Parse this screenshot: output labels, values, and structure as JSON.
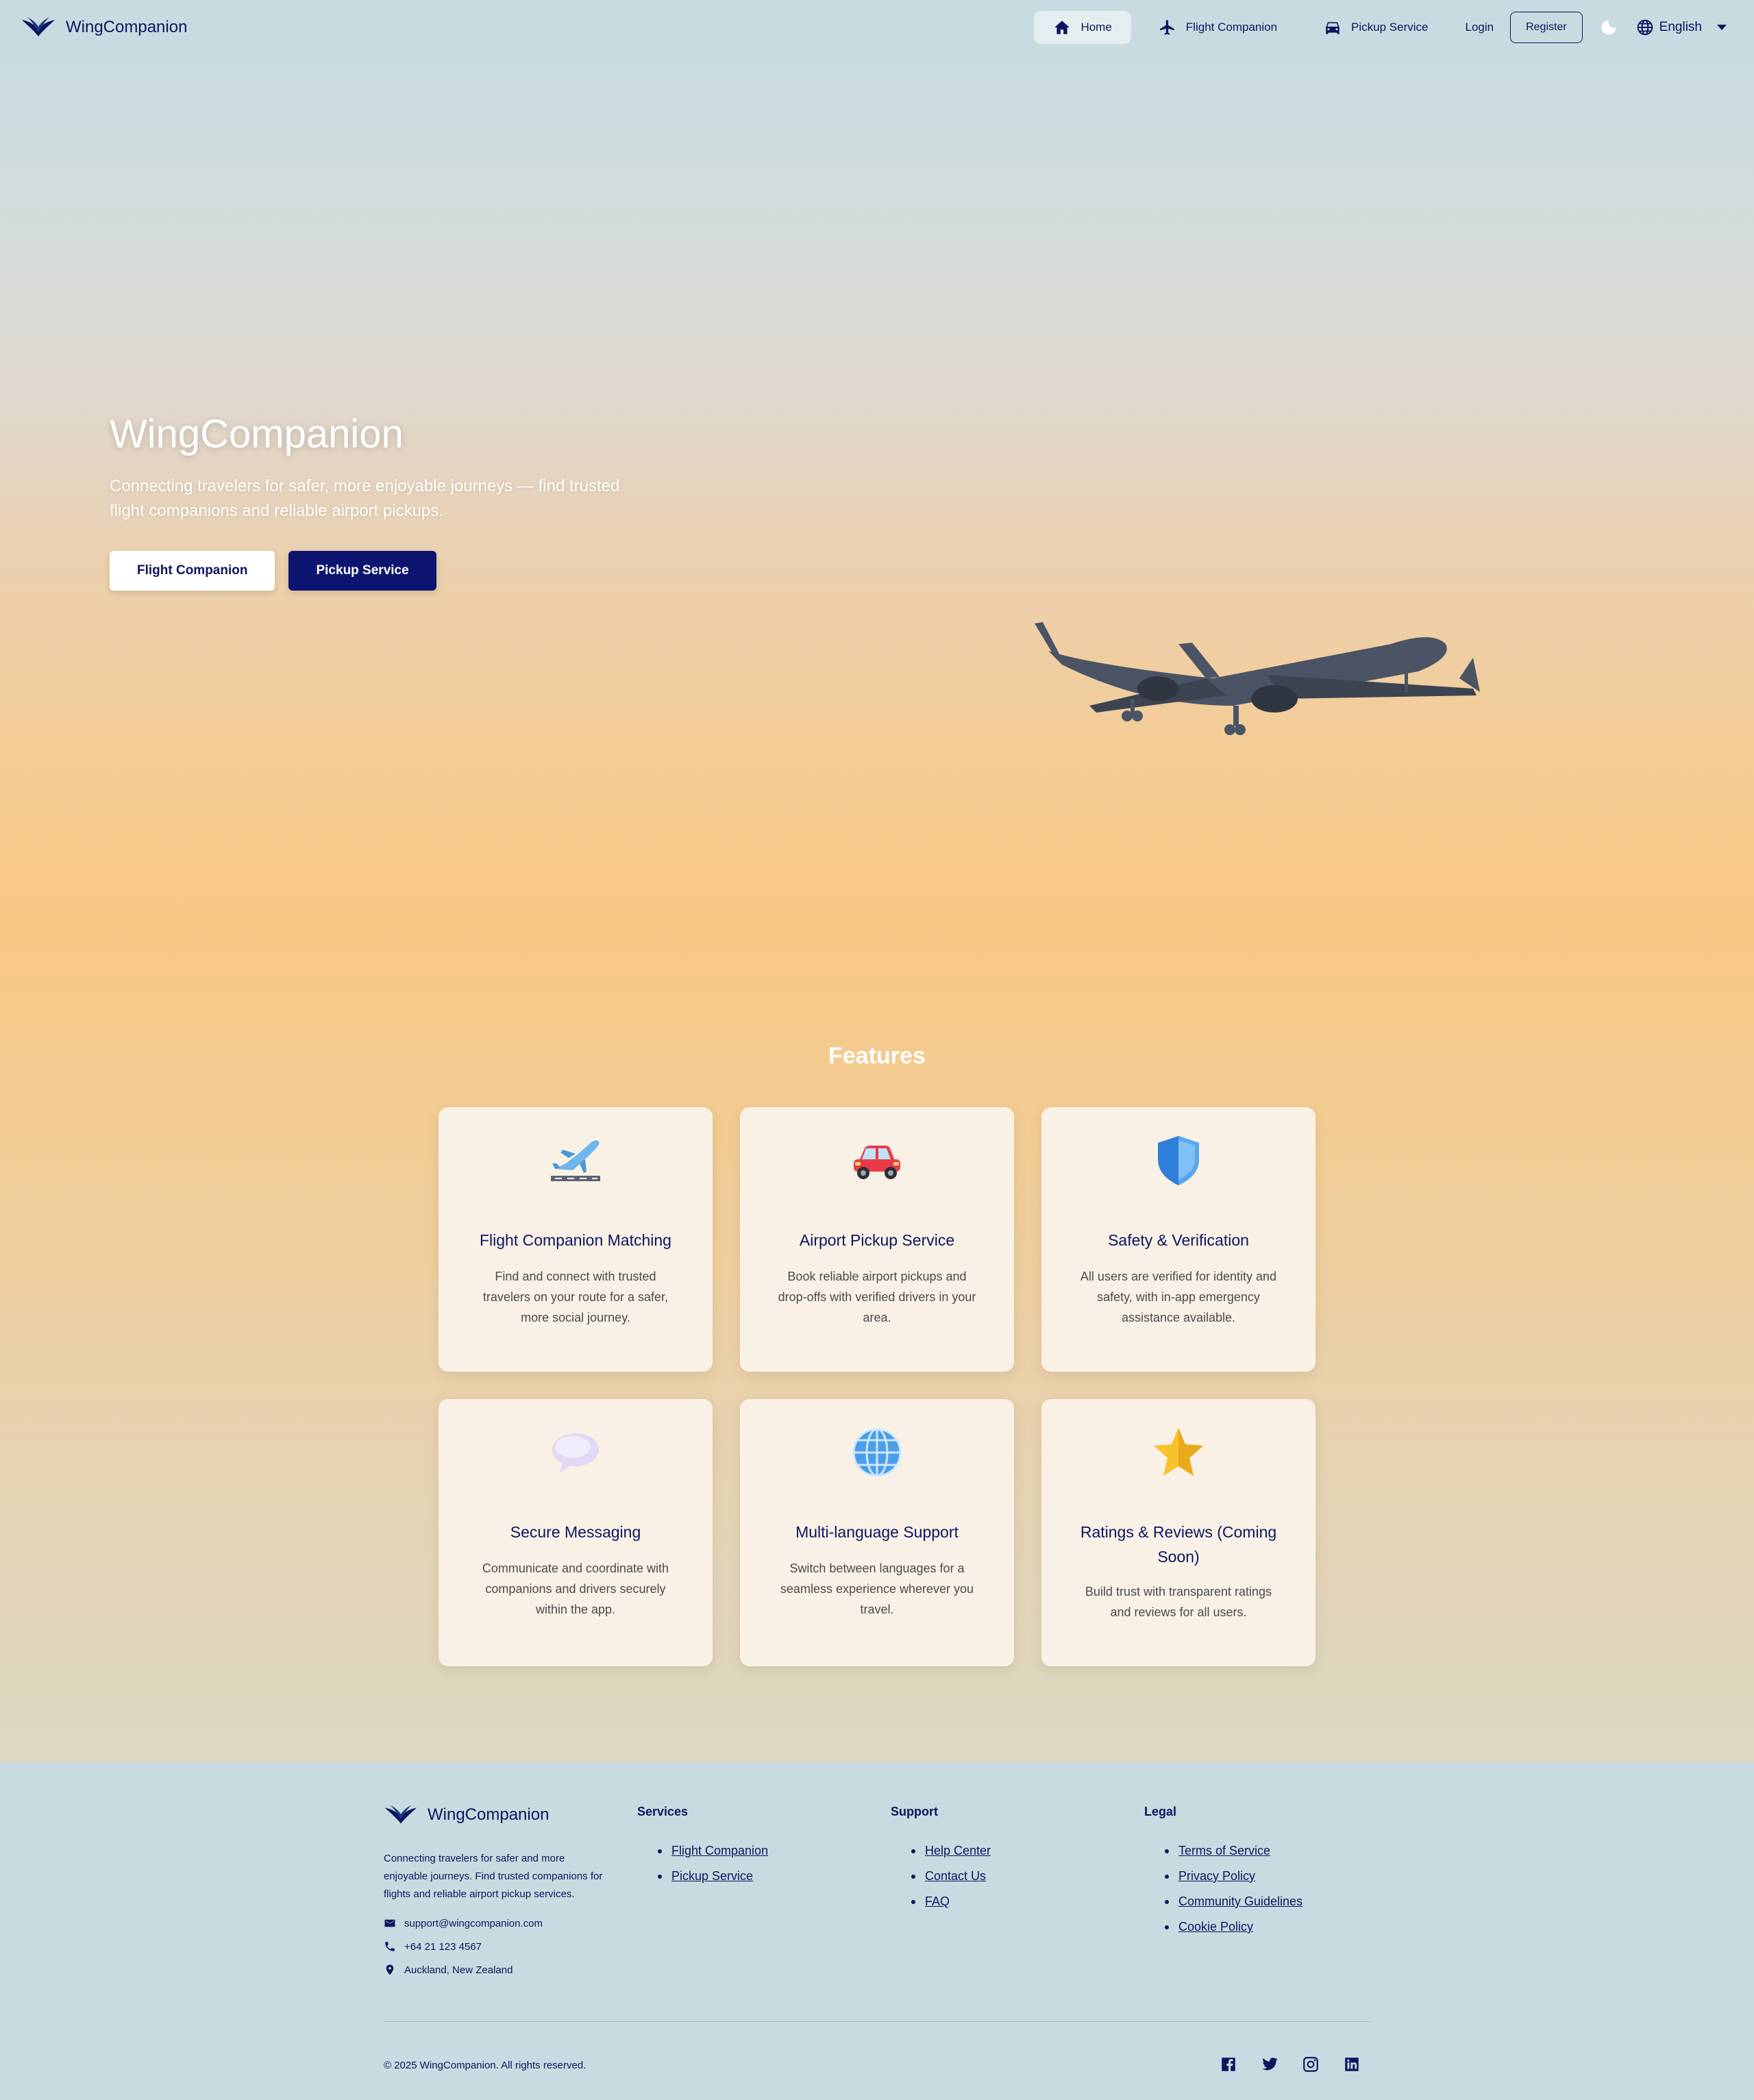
{
  "nav": {
    "brand": "WingCompanion",
    "links": [
      {
        "label": "Home",
        "icon": "home-icon",
        "active": true
      },
      {
        "label": "Flight Companion",
        "icon": "airplane-icon",
        "active": false
      },
      {
        "label": "Pickup Service",
        "icon": "car-icon",
        "active": false
      }
    ],
    "login": "Login",
    "register": "Register",
    "language": "English"
  },
  "hero": {
    "title": "WingCompanion",
    "subtitle": "Connecting travelers for safer, more enjoyable journeys — find trusted flight companions and reliable airport pickups.",
    "buttons": [
      "Flight Companion",
      "Pickup Service"
    ]
  },
  "features": {
    "title": "Features",
    "cards": [
      {
        "icon": "airplane-departure-icon",
        "title": "Flight Companion Matching",
        "desc": "Find and connect with trusted travelers on your route for a safer, more social journey."
      },
      {
        "icon": "car-icon",
        "title": "Airport Pickup Service",
        "desc": "Book reliable airport pickups and drop-offs with verified drivers in your area."
      },
      {
        "icon": "shield-icon",
        "title": "Safety & Verification",
        "desc": "All users are verified for identity and safety, with in-app emergency assistance available."
      },
      {
        "icon": "speech-bubble-icon",
        "title": "Secure Messaging",
        "desc": "Communicate and coordinate with companions and drivers securely within the app."
      },
      {
        "icon": "globe-icon",
        "title": "Multi-language Support",
        "desc": "Switch between languages for a seamless experience wherever you travel."
      },
      {
        "icon": "star-icon",
        "title": "Ratings & Reviews (Coming Soon)",
        "desc": "Build trust with transparent ratings and reviews for all users."
      }
    ]
  },
  "footer": {
    "brand": "WingCompanion",
    "about": "Connecting travelers for safer and more enjoyable journeys. Find trusted companions for flights and reliable airport pickup services.",
    "email": "support@wingcompanion.com",
    "phone": "+64 21 123 4567",
    "location": "Auckland, New Zealand",
    "columns": [
      {
        "title": "Services",
        "links": [
          "Flight Companion",
          "Pickup Service"
        ]
      },
      {
        "title": "Support",
        "links": [
          "Help Center",
          "Contact Us",
          "FAQ"
        ]
      },
      {
        "title": "Legal",
        "links": [
          "Terms of Service",
          "Privacy Policy",
          "Community Guidelines",
          "Cookie Policy"
        ]
      }
    ],
    "copyright": "© 2025 WingCompanion. All rights reserved.",
    "socials": [
      "facebook-icon",
      "twitter-icon",
      "instagram-icon",
      "linkedin-icon"
    ]
  },
  "colors": {
    "primary": "#0b1560",
    "accent": "#0d1470",
    "sky": "#c8dbe0",
    "sunset": "#f9c884"
  }
}
